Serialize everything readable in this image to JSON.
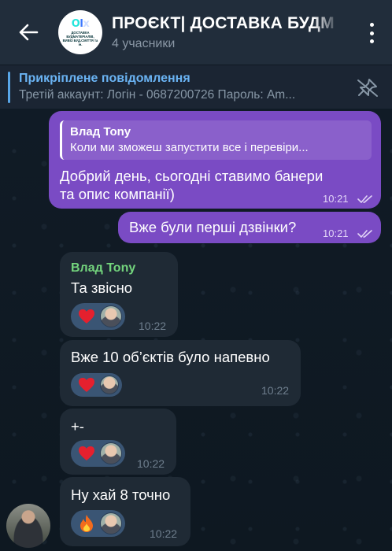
{
  "header": {
    "title": "ПРОЄКТ| ДОСТАВКА БУДМ",
    "subtitle": "4 учасники",
    "avatar_logo_o": "O",
    "avatar_logo_l": "l",
    "avatar_logo_x": "x",
    "avatar_caption": "ДОСТАВКА БУДМАТЕРІАЛІВ, ВИВІЗ БУД.СМІТТЯ та ін."
  },
  "pinned": {
    "title": "Прикріплене повідомлення",
    "text": "Третій аккаунт: Логін - 0687200726  Пароль: Am..."
  },
  "messages": {
    "m1": {
      "reply_name": "Влад Tony",
      "reply_text": "Коли ми зможеш запустити все і перевіри...",
      "text_line1": "Добрий день, сьогодні ставимо банери",
      "text_line2": "та опис компанії)",
      "time": "10:21"
    },
    "m2": {
      "text": "Вже були перші дзвінки?",
      "time": "10:21"
    },
    "m3": {
      "sender": "Влад Tony",
      "text": "Та звісно",
      "time": "10:22",
      "reaction": "heart"
    },
    "m4": {
      "text": "Вже 10 об’єктів було напевно",
      "time": "10:22",
      "reaction": "heart"
    },
    "m5": {
      "text": "+-",
      "time": "10:22",
      "reaction": "heart"
    },
    "m6": {
      "text": "Ну хай 8 точно",
      "time": "10:22",
      "reaction": "fire"
    }
  },
  "colors": {
    "outgoing_bubble": "#7a4bc4",
    "incoming_bubble": "#1f2a35",
    "header_bg": "#212d3b",
    "sender_name": "#73d47d",
    "link_blue": "#6ab3f3"
  },
  "icons": [
    "back-arrow-icon",
    "more-vertical-icon",
    "unpin-icon",
    "double-check-icon",
    "heart-emoji-icon",
    "fire-emoji-icon"
  ]
}
